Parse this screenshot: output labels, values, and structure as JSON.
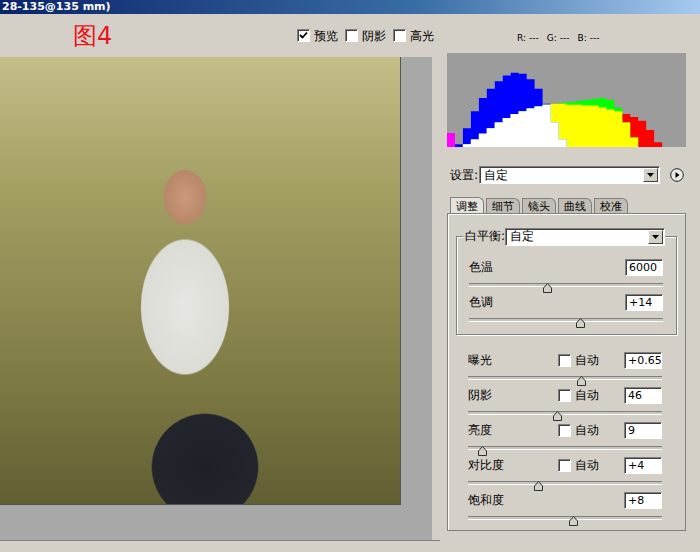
{
  "window": {
    "title": "28-135@135 mm)"
  },
  "caption": "图4",
  "view_options": [
    {
      "label": "预览",
      "checked": true
    },
    {
      "label": "阴影",
      "checked": false
    },
    {
      "label": "高光",
      "checked": false
    }
  ],
  "readout": [
    {
      "label": "R:",
      "value": "---"
    },
    {
      "label": "G:",
      "value": "---"
    },
    {
      "label": "B:",
      "value": "---"
    }
  ],
  "histogram": {
    "series": [
      {
        "color": "#ff0000",
        "values": [
          15,
          0,
          3,
          8,
          14,
          20,
          26,
          31,
          35,
          38,
          41,
          43,
          45,
          46,
          46,
          45,
          45,
          44,
          44,
          42,
          40,
          38,
          35,
          32,
          28,
          18,
          5,
          0,
          0,
          0
        ]
      },
      {
        "color": "#00ff00",
        "values": [
          0,
          0,
          3,
          8,
          14,
          20,
          26,
          31,
          35,
          38,
          41,
          43,
          45,
          46,
          47,
          48,
          49,
          50,
          51,
          52,
          50,
          42,
          26,
          10,
          0,
          0,
          0,
          0,
          0,
          0
        ]
      },
      {
        "color": "#0000ff",
        "values": [
          15,
          3,
          20,
          38,
          52,
          62,
          70,
          76,
          79,
          78,
          72,
          62,
          46,
          26,
          8,
          0,
          0,
          0,
          0,
          0,
          0,
          0,
          0,
          0,
          0,
          0,
          0,
          0,
          0,
          0
        ]
      }
    ]
  },
  "settings": {
    "label": "设置:",
    "value": "自定"
  },
  "tabs": [
    {
      "label": "调整",
      "selected": true
    },
    {
      "label": "细节",
      "selected": false
    },
    {
      "label": "镜头",
      "selected": false
    },
    {
      "label": "曲线",
      "selected": false
    },
    {
      "label": "校准",
      "selected": false
    }
  ],
  "white_balance": {
    "label": "白平衡:",
    "value": "自定",
    "sliders": [
      {
        "label": "色温",
        "value": "6000",
        "level": 0.4
      },
      {
        "label": "色调",
        "value": "+14",
        "level": 0.57
      }
    ]
  },
  "adjustments": [
    {
      "kind": "auto",
      "label": "曝光",
      "auto_label": "自动",
      "auto": false,
      "value": "+0.65",
      "level": 0.58
    },
    {
      "kind": "auto",
      "label": "阴影",
      "auto_label": "自动",
      "auto": false,
      "value": "46",
      "level": 0.46
    },
    {
      "kind": "auto",
      "label": "亮度",
      "auto_label": "自动",
      "auto": false,
      "value": "9",
      "level": 0.07
    },
    {
      "kind": "auto",
      "label": "对比度",
      "auto_label": "自动",
      "auto": false,
      "value": "+4",
      "level": 0.36
    },
    {
      "kind": "plain",
      "label": "饱和度",
      "value": "+8",
      "level": 0.54
    }
  ]
}
